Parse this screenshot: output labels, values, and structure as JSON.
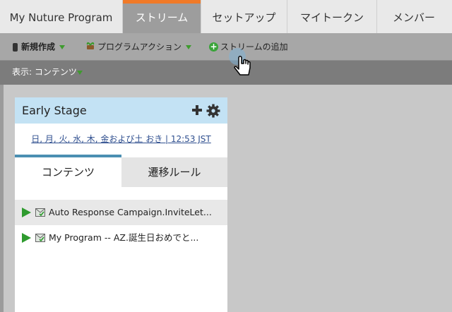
{
  "tabs": [
    {
      "label": "My Nuture Program",
      "active": false
    },
    {
      "label": "ストリーム",
      "active": true
    },
    {
      "label": "セットアップ",
      "active": false
    },
    {
      "label": "マイトークン",
      "active": false
    },
    {
      "label": "メンバー",
      "active": false
    }
  ],
  "toolbar": {
    "new_label": "新規作成",
    "program_actions_label": "プログラムアクション",
    "add_stream_label": "ストリームの追加"
  },
  "view": {
    "label": "表示: コンテンツ"
  },
  "stream": {
    "title": "Early Stage",
    "schedule": "日, 月, 火, 水, 木, 金および土 おき | 12:53 JST",
    "tabs": [
      {
        "label": "コンテンツ",
        "active": true
      },
      {
        "label": "遷移ルール",
        "active": false
      }
    ],
    "items": [
      {
        "label": "Auto Response Campaign.InviteLet..."
      },
      {
        "label": "My Program -- AZ.誕生日おめでと..."
      }
    ]
  },
  "colors": {
    "accent_orange": "#f07a28",
    "stream_header": "#c3e2f4",
    "active_tab_underline": "#4a8fb2",
    "green_icon": "#3aa43a"
  },
  "icons": [
    "new-item-icon",
    "program-actions-icon",
    "add-stream-icon",
    "chevron-down-icon",
    "plus-icon",
    "gear-icon",
    "play-icon",
    "email-icon",
    "hand-cursor-icon"
  ]
}
